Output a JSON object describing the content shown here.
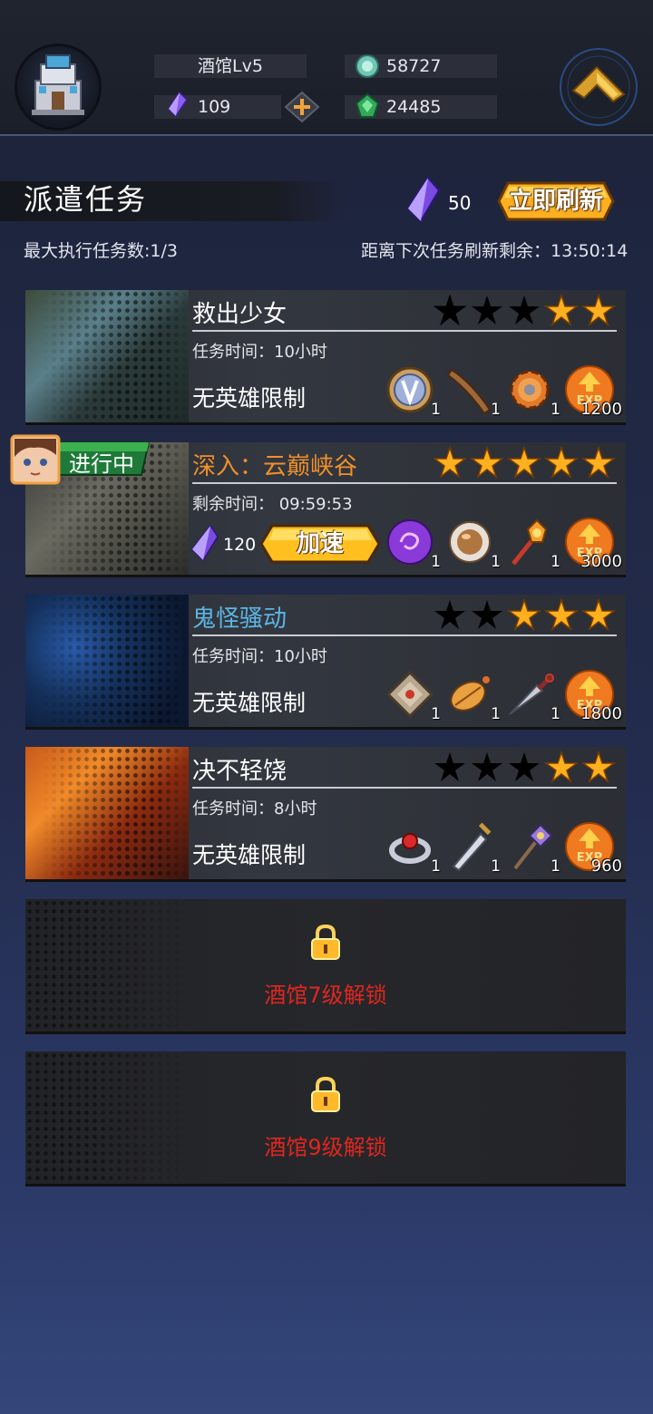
{
  "header": {
    "tavern_level": "酒馆Lv5",
    "crystals": "109",
    "coins": "58727",
    "green_gems": "24485"
  },
  "dispatch": {
    "title": "派遣任务",
    "refresh_cost": "50",
    "refresh_label": "立即刷新",
    "max_tasks": "最大执行任务数:1/3",
    "next_refresh": "距离下次任务刷新剩余：13:50:14"
  },
  "tasks": [
    {
      "title": "救出少女",
      "title_color": "#ffffff",
      "time": "任务时间：10小时",
      "limit": "无英雄限制",
      "stars": 2,
      "rewards": [
        {
          "icon": "coin-token-icon",
          "count": "1"
        },
        {
          "icon": "wooden-club-icon",
          "count": "1"
        },
        {
          "icon": "gear-icon",
          "count": "1"
        }
      ],
      "exp": "1200"
    },
    {
      "title": "深入：云巅峡谷",
      "title_color": "#f0902a",
      "status": "进行中",
      "time": "剩余时间：  09:59:53",
      "speedup_cost": "120",
      "speedup_label": "加速",
      "stars": 5,
      "rewards": [
        {
          "icon": "purple-orb-icon",
          "count": "1"
        },
        {
          "icon": "brown-orb-icon",
          "count": "1"
        },
        {
          "icon": "medal-wand-icon",
          "count": "1"
        }
      ],
      "exp": "3000"
    },
    {
      "title": "鬼怪骚动",
      "title_color": "#5bb6e6",
      "time": "任务时间：10小时",
      "limit": "无英雄限制",
      "stars": 3,
      "rewards": [
        {
          "icon": "spellbook-icon",
          "count": "1"
        },
        {
          "icon": "seed-pod-icon",
          "count": "1"
        },
        {
          "icon": "kunai-icon",
          "count": "1"
        }
      ],
      "exp": "1800"
    },
    {
      "title": "决不轻饶",
      "title_color": "#ffffff",
      "time": "任务时间：8小时",
      "limit": "无英雄限制",
      "stars": 2,
      "rewards": [
        {
          "icon": "ruby-ring-icon",
          "count": "1"
        },
        {
          "icon": "sword-icon",
          "count": "1"
        },
        {
          "icon": "staff-icon",
          "count": "1"
        }
      ],
      "exp": "960"
    }
  ],
  "locked_slots": [
    {
      "text": "酒馆7级解锁"
    },
    {
      "text": "酒馆9级解锁"
    }
  ],
  "colors": {
    "gold": "#ffb020",
    "locked_red": "#e0261f",
    "crystal": "#8a5cf0"
  }
}
